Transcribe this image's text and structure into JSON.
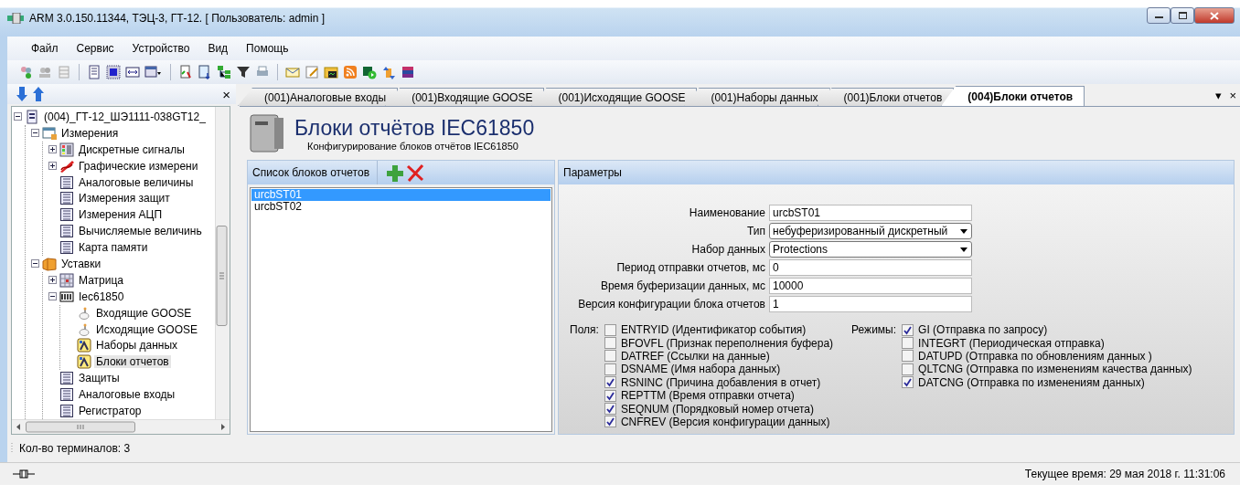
{
  "window": {
    "title": "ARM 3.0.150.11344, ТЭЦ-3, ГТ-12. [ Пользователь: admin ]"
  },
  "menu": [
    "Файл",
    "Сервис",
    "Устройство",
    "Вид",
    "Помощь"
  ],
  "tree_panel": {
    "close": "×",
    "status": "Кол-во терминалов: 3",
    "tree": [
      {
        "label": "(004)_ГТ-12_ШЭ1111-038GT12_",
        "kind": "device",
        "expanded": true,
        "selected": false,
        "children": [
          {
            "label": "Измерения",
            "kind": "measure",
            "expanded": true,
            "selected": false,
            "children": [
              {
                "label": "Дискретные сигналы",
                "kind": "signals",
                "expanded": false,
                "selected": false
              },
              {
                "label": "Графические измерени",
                "kind": "graph",
                "expanded": false,
                "selected": false
              },
              {
                "label": "Аналоговые величины",
                "kind": "table",
                "selected": false
              },
              {
                "label": "Измерения защит",
                "kind": "table",
                "selected": false
              },
              {
                "label": "Измерения АЦП",
                "kind": "table",
                "selected": false
              },
              {
                "label": "Вычисляемые величинь",
                "kind": "table",
                "selected": false
              },
              {
                "label": "Карта памяти",
                "kind": "table",
                "selected": false
              }
            ]
          },
          {
            "label": "Уставки",
            "kind": "folder",
            "expanded": true,
            "selected": false,
            "children": [
              {
                "label": "Матрица",
                "kind": "matrix",
                "expanded": false,
                "selected": false
              },
              {
                "label": "Iec61850",
                "kind": "iec",
                "expanded": true,
                "selected": false,
                "children": [
                  {
                    "label": "Входящие GOOSE",
                    "kind": "goose",
                    "selected": false
                  },
                  {
                    "label": "Исходящие GOOSE",
                    "kind": "goose",
                    "selected": false
                  },
                  {
                    "label": "Наборы данных",
                    "kind": "dataset",
                    "selected": false
                  },
                  {
                    "label": "Блоки отчетов",
                    "kind": "dataset",
                    "selected": true
                  }
                ]
              },
              {
                "label": "Защиты",
                "kind": "table",
                "selected": false
              },
              {
                "label": "Аналоговые входы",
                "kind": "table",
                "selected": false
              },
              {
                "label": "Регистратор",
                "kind": "table",
                "selected": false
              }
            ]
          }
        ]
      }
    ]
  },
  "tabs": [
    {
      "label": "(001)Аналоговые входы",
      "selected": false
    },
    {
      "label": "(001)Входящие GOOSE",
      "selected": false
    },
    {
      "label": "(001)Исходящие GOOSE",
      "selected": false
    },
    {
      "label": "(001)Наборы данных",
      "selected": false
    },
    {
      "label": "(001)Блоки отчетов",
      "selected": false
    },
    {
      "label": "(004)Блоки отчетов",
      "selected": true
    }
  ],
  "tab_controls": {
    "menu": "▾",
    "close": "×"
  },
  "header": {
    "title": "Блоки отчётов IEC61850",
    "subtitle": "Конфигурирование блоков отчётов IEC61850"
  },
  "report_list": {
    "title": "Список блоков отчетов",
    "items": [
      {
        "label": "urcbST01",
        "selected": true
      },
      {
        "label": "urcbST02",
        "selected": false
      }
    ]
  },
  "parameters": {
    "title": "Параметры",
    "fields": [
      {
        "label": "Наименование",
        "kind": "text",
        "value": "urcbST01"
      },
      {
        "label": "Тип",
        "kind": "select",
        "value": "небуферизированный дискретный"
      },
      {
        "label": "Набор данных",
        "kind": "select",
        "value": "Protections"
      },
      {
        "label": "Период отправки отчетов, мс",
        "kind": "text",
        "value": "0"
      },
      {
        "label": "Время буферизации данных, мс",
        "kind": "text",
        "value": "10000"
      },
      {
        "label": "Версия конфигурации блока отчетов",
        "kind": "text",
        "value": "1"
      }
    ],
    "groups": [
      {
        "label": "Поля:",
        "options": [
          {
            "label": "ENTRYID (Идентификатор события)",
            "checked": false
          },
          {
            "label": "BFOVFL (Признак переполнения буфера)",
            "checked": false
          },
          {
            "label": "DATREF (Ссылки на данные)",
            "checked": false
          },
          {
            "label": "DSNAME (Имя набора данных)",
            "checked": false
          },
          {
            "label": "RSNINC (Причина добавления в отчет)",
            "checked": true
          },
          {
            "label": "REPTTM (Время отправки отчета)",
            "checked": true
          },
          {
            "label": "SEQNUM (Порядковый номер отчета)",
            "checked": true
          },
          {
            "label": "CNFREV (Версия конфигурации данных)",
            "checked": true
          }
        ]
      },
      {
        "label": "Режимы:",
        "options": [
          {
            "label": "GI (Отправка по запросу)",
            "checked": true
          },
          {
            "label": "INTEGRT (Периодическая отправка)",
            "checked": false
          },
          {
            "label": "DATUPD (Отправка по обновлениям данных )",
            "checked": false
          },
          {
            "label": "QLTCNG (Отправка по изменениям качества данных)",
            "checked": false
          },
          {
            "label": "DATCNG (Отправка по изменениям данных)",
            "checked": true
          }
        ]
      }
    ]
  },
  "status_bar": {
    "time": "Текущее время: 29 мая 2018 г. 11:31:06"
  }
}
